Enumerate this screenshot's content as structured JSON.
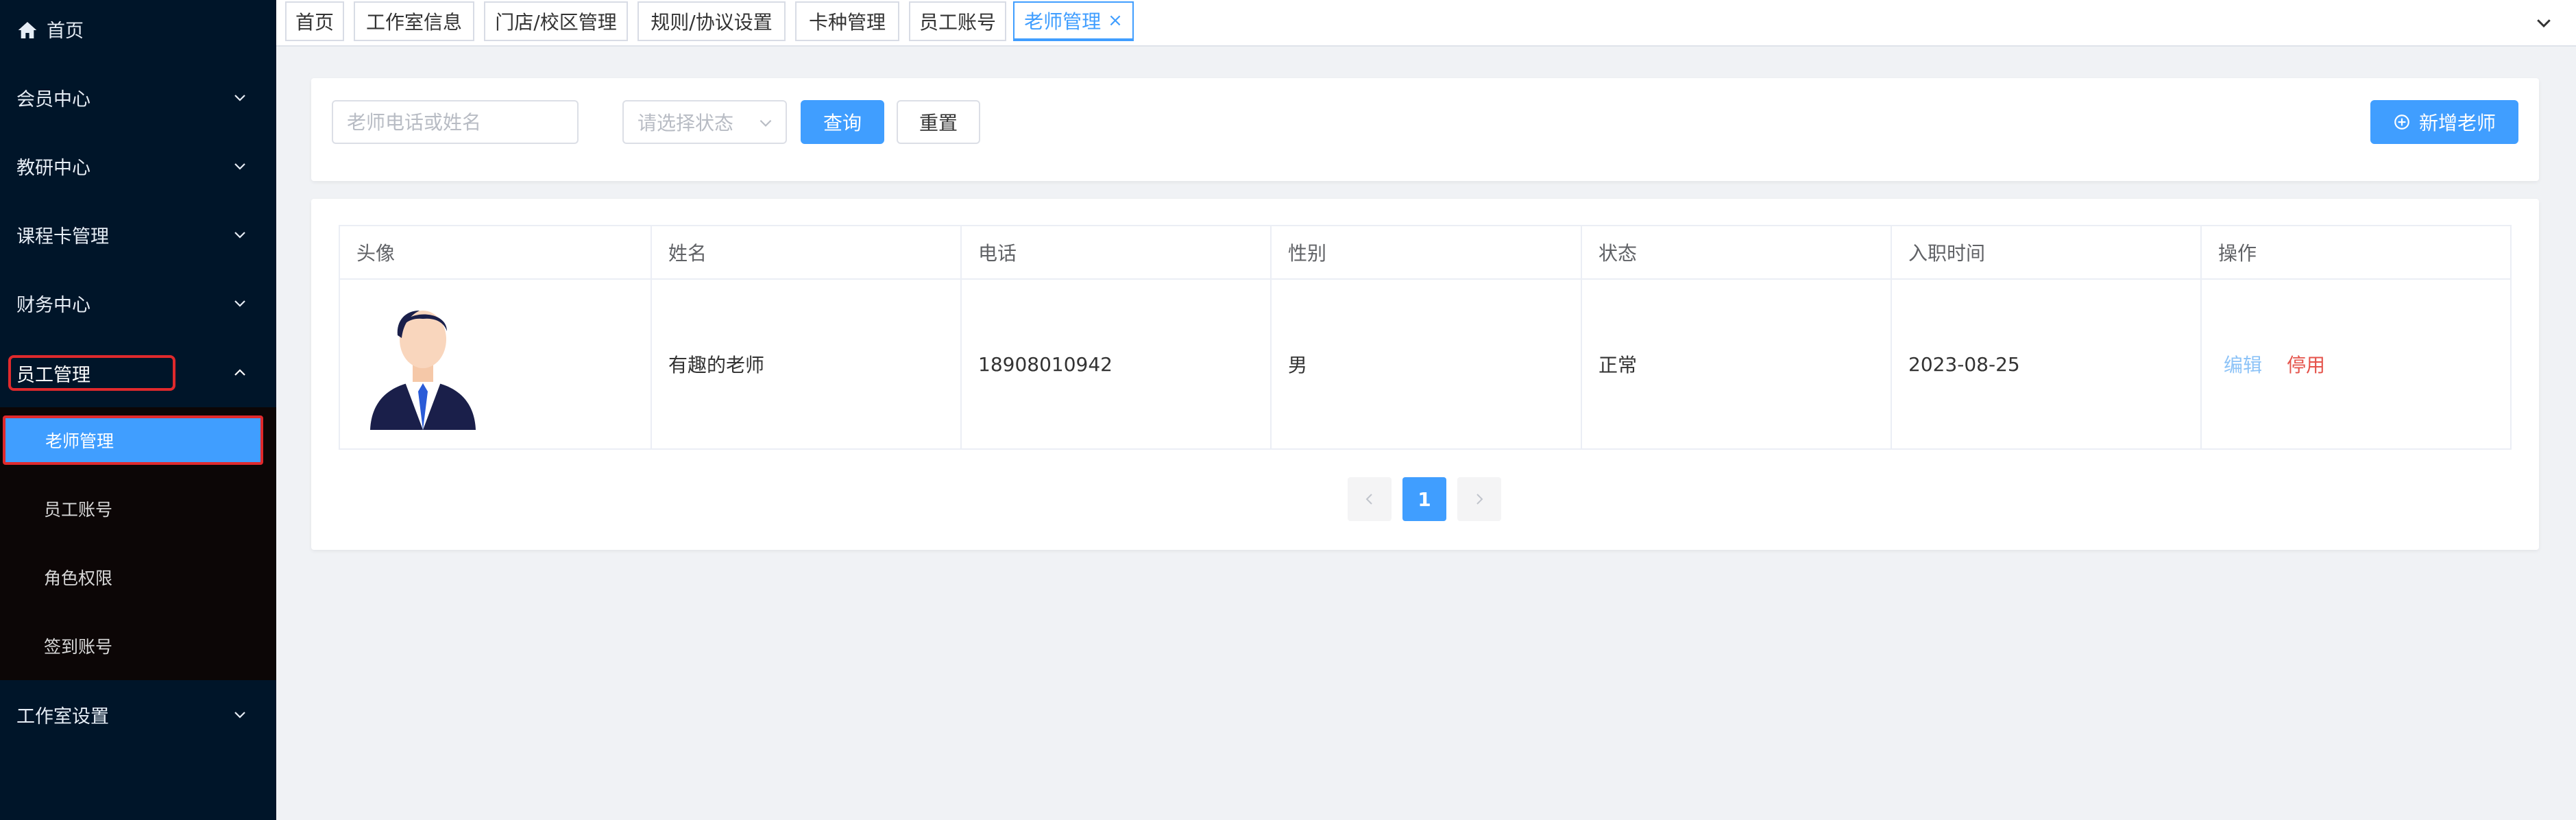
{
  "colors": {
    "sidebar_bg": "#001529",
    "submenu_bg": "#0c0606",
    "accent": "#409eff",
    "highlight_box": "#e0292c",
    "danger": "#e5534b"
  },
  "sidebar": {
    "home_label": "首页",
    "groups": [
      {
        "label": "会员中心"
      },
      {
        "label": "教研中心"
      },
      {
        "label": "课程卡管理"
      },
      {
        "label": "财务中心"
      },
      {
        "label": "员工管理",
        "expanded": true
      },
      {
        "label": "工作室设置"
      }
    ],
    "staff_submenu": [
      {
        "label": "老师管理",
        "active": true
      },
      {
        "label": "员工账号"
      },
      {
        "label": "角色权限"
      },
      {
        "label": "签到账号"
      }
    ]
  },
  "tabs": [
    {
      "label": "首页"
    },
    {
      "label": "工作室信息"
    },
    {
      "label": "门店/校区管理"
    },
    {
      "label": "规则/协议设置"
    },
    {
      "label": "卡种管理"
    },
    {
      "label": "员工账号"
    },
    {
      "label": "老师管理",
      "active": true,
      "close_symbol": "×"
    }
  ],
  "filter": {
    "search_placeholder": "老师电话或姓名",
    "status_placeholder": "请选择状态",
    "query_label": "查询",
    "reset_label": "重置",
    "add_label": "新增老师"
  },
  "table": {
    "headers": [
      "头像",
      "姓名",
      "电话",
      "性别",
      "状态",
      "入职时间",
      "操作"
    ],
    "rows": [
      {
        "avatar_icon": "teacher-avatar-icon",
        "name": "有趣的老师",
        "phone": "18908010942",
        "gender": "男",
        "status": "正常",
        "hire_date": "2023-08-25",
        "actions": [
          "编辑",
          "停用"
        ]
      }
    ]
  },
  "pagination": {
    "current_page": "1"
  }
}
